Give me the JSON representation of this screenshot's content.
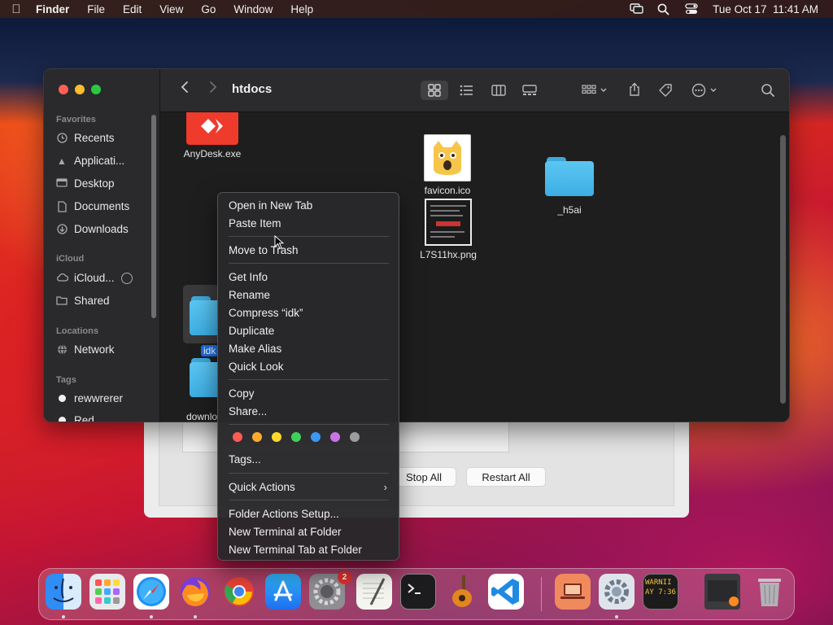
{
  "menubar": {
    "app": "Finder",
    "items": [
      "File",
      "Edit",
      "View",
      "Go",
      "Window",
      "Help"
    ],
    "clock": "Tue Oct 17  11:41 AM"
  },
  "finder": {
    "title": "htdocs",
    "sidebar": {
      "favorites_heading": "Favorites",
      "favorites": [
        "Recents",
        "Applicati...",
        "Desktop",
        "Documents",
        "Downloads"
      ],
      "icloud_heading": "iCloud",
      "icloud": [
        "iCloud...",
        "Shared"
      ],
      "locations_heading": "Locations",
      "locations": [
        "Network"
      ],
      "tags_heading": "Tags",
      "tags": [
        "rewwrerer",
        "Red"
      ]
    },
    "files": {
      "anydesk": "AnyDesk.exe",
      "favicon": "favicon.ico",
      "h5ai": "_h5ai",
      "png": "L7S11hx.png",
      "idk": "idk",
      "downloads": "downlo"
    }
  },
  "context_menu": {
    "open_new_tab": "Open in New Tab",
    "paste_item": "Paste Item",
    "move_to_trash": "Move to Trash",
    "get_info": "Get Info",
    "rename": "Rename",
    "compress": "Compress “idk”",
    "duplicate": "Duplicate",
    "make_alias": "Make Alias",
    "quick_look": "Quick Look",
    "copy": "Copy",
    "share": "Share...",
    "tags": "Tags...",
    "quick_actions": "Quick Actions",
    "folder_actions": "Folder Actions Setup...",
    "new_terminal": "New Terminal at Folder",
    "new_terminal_tab": "New Terminal Tab at Folder",
    "tag_colors": [
      "#ff5b54",
      "#ffab2e",
      "#ffd92c",
      "#3fd05a",
      "#3b98f6",
      "#c874e8",
      "#9c9ca0"
    ]
  },
  "background_window": {
    "stop_all": "Stop All",
    "restart_all": "Restart All"
  },
  "dock": {
    "settings_badge": "2",
    "console_text": "WARNII AY 7:36"
  }
}
